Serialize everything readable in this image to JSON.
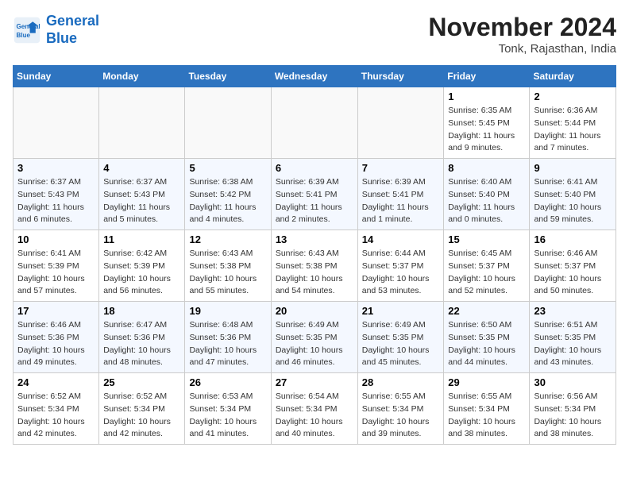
{
  "logo": {
    "line1": "General",
    "line2": "Blue"
  },
  "title": "November 2024",
  "subtitle": "Tonk, Rajasthan, India",
  "weekdays": [
    "Sunday",
    "Monday",
    "Tuesday",
    "Wednesday",
    "Thursday",
    "Friday",
    "Saturday"
  ],
  "weeks": [
    [
      {
        "day": "",
        "detail": ""
      },
      {
        "day": "",
        "detail": ""
      },
      {
        "day": "",
        "detail": ""
      },
      {
        "day": "",
        "detail": ""
      },
      {
        "day": "",
        "detail": ""
      },
      {
        "day": "1",
        "detail": "Sunrise: 6:35 AM\nSunset: 5:45 PM\nDaylight: 11 hours and 9 minutes."
      },
      {
        "day": "2",
        "detail": "Sunrise: 6:36 AM\nSunset: 5:44 PM\nDaylight: 11 hours and 7 minutes."
      }
    ],
    [
      {
        "day": "3",
        "detail": "Sunrise: 6:37 AM\nSunset: 5:43 PM\nDaylight: 11 hours and 6 minutes."
      },
      {
        "day": "4",
        "detail": "Sunrise: 6:37 AM\nSunset: 5:43 PM\nDaylight: 11 hours and 5 minutes."
      },
      {
        "day": "5",
        "detail": "Sunrise: 6:38 AM\nSunset: 5:42 PM\nDaylight: 11 hours and 4 minutes."
      },
      {
        "day": "6",
        "detail": "Sunrise: 6:39 AM\nSunset: 5:41 PM\nDaylight: 11 hours and 2 minutes."
      },
      {
        "day": "7",
        "detail": "Sunrise: 6:39 AM\nSunset: 5:41 PM\nDaylight: 11 hours and 1 minute."
      },
      {
        "day": "8",
        "detail": "Sunrise: 6:40 AM\nSunset: 5:40 PM\nDaylight: 11 hours and 0 minutes."
      },
      {
        "day": "9",
        "detail": "Sunrise: 6:41 AM\nSunset: 5:40 PM\nDaylight: 10 hours and 59 minutes."
      }
    ],
    [
      {
        "day": "10",
        "detail": "Sunrise: 6:41 AM\nSunset: 5:39 PM\nDaylight: 10 hours and 57 minutes."
      },
      {
        "day": "11",
        "detail": "Sunrise: 6:42 AM\nSunset: 5:39 PM\nDaylight: 10 hours and 56 minutes."
      },
      {
        "day": "12",
        "detail": "Sunrise: 6:43 AM\nSunset: 5:38 PM\nDaylight: 10 hours and 55 minutes."
      },
      {
        "day": "13",
        "detail": "Sunrise: 6:43 AM\nSunset: 5:38 PM\nDaylight: 10 hours and 54 minutes."
      },
      {
        "day": "14",
        "detail": "Sunrise: 6:44 AM\nSunset: 5:37 PM\nDaylight: 10 hours and 53 minutes."
      },
      {
        "day": "15",
        "detail": "Sunrise: 6:45 AM\nSunset: 5:37 PM\nDaylight: 10 hours and 52 minutes."
      },
      {
        "day": "16",
        "detail": "Sunrise: 6:46 AM\nSunset: 5:37 PM\nDaylight: 10 hours and 50 minutes."
      }
    ],
    [
      {
        "day": "17",
        "detail": "Sunrise: 6:46 AM\nSunset: 5:36 PM\nDaylight: 10 hours and 49 minutes."
      },
      {
        "day": "18",
        "detail": "Sunrise: 6:47 AM\nSunset: 5:36 PM\nDaylight: 10 hours and 48 minutes."
      },
      {
        "day": "19",
        "detail": "Sunrise: 6:48 AM\nSunset: 5:36 PM\nDaylight: 10 hours and 47 minutes."
      },
      {
        "day": "20",
        "detail": "Sunrise: 6:49 AM\nSunset: 5:35 PM\nDaylight: 10 hours and 46 minutes."
      },
      {
        "day": "21",
        "detail": "Sunrise: 6:49 AM\nSunset: 5:35 PM\nDaylight: 10 hours and 45 minutes."
      },
      {
        "day": "22",
        "detail": "Sunrise: 6:50 AM\nSunset: 5:35 PM\nDaylight: 10 hours and 44 minutes."
      },
      {
        "day": "23",
        "detail": "Sunrise: 6:51 AM\nSunset: 5:35 PM\nDaylight: 10 hours and 43 minutes."
      }
    ],
    [
      {
        "day": "24",
        "detail": "Sunrise: 6:52 AM\nSunset: 5:34 PM\nDaylight: 10 hours and 42 minutes."
      },
      {
        "day": "25",
        "detail": "Sunrise: 6:52 AM\nSunset: 5:34 PM\nDaylight: 10 hours and 42 minutes."
      },
      {
        "day": "26",
        "detail": "Sunrise: 6:53 AM\nSunset: 5:34 PM\nDaylight: 10 hours and 41 minutes."
      },
      {
        "day": "27",
        "detail": "Sunrise: 6:54 AM\nSunset: 5:34 PM\nDaylight: 10 hours and 40 minutes."
      },
      {
        "day": "28",
        "detail": "Sunrise: 6:55 AM\nSunset: 5:34 PM\nDaylight: 10 hours and 39 minutes."
      },
      {
        "day": "29",
        "detail": "Sunrise: 6:55 AM\nSunset: 5:34 PM\nDaylight: 10 hours and 38 minutes."
      },
      {
        "day": "30",
        "detail": "Sunrise: 6:56 AM\nSunset: 5:34 PM\nDaylight: 10 hours and 38 minutes."
      }
    ]
  ]
}
